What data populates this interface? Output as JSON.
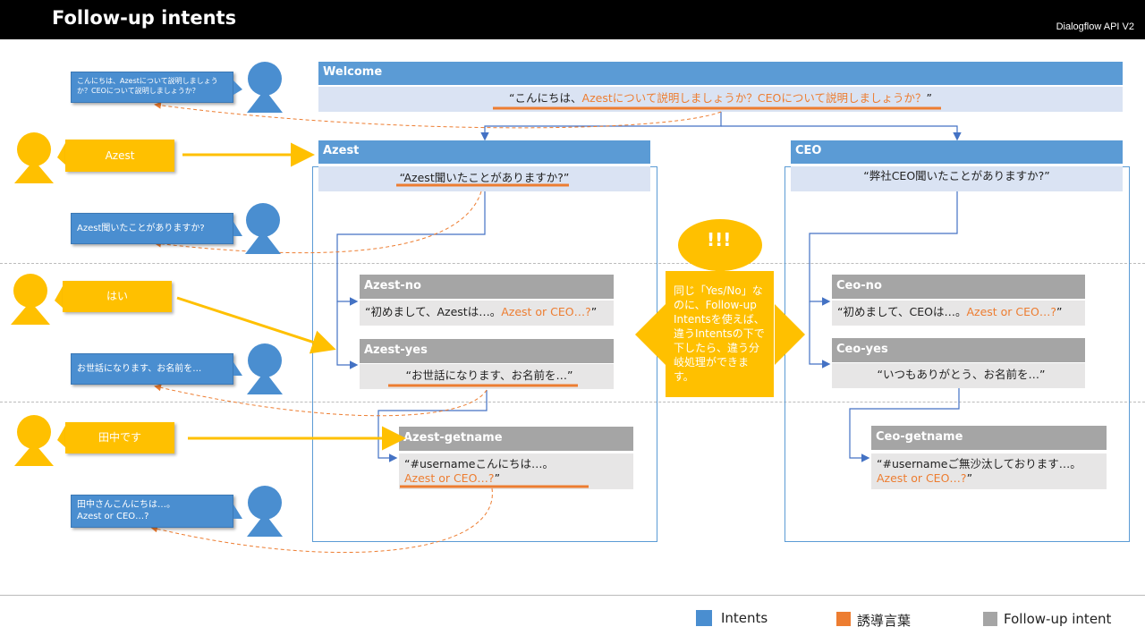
{
  "header": {
    "title": "Follow-up intents",
    "brand": "Dialogflow  API V2"
  },
  "welcome": {
    "name": "Welcome",
    "quote_open": "“こんにちは、",
    "quote_orange": "Azestについて説明しましょうか？CEOについて説明しましょうか？",
    "quote_close": "”"
  },
  "azest": {
    "name": "Azest",
    "quote": "“Azest聞いたことがありますか?”",
    "no": {
      "name": "Azest-no",
      "quote_open": "“初めまして、Azestは…。",
      "quote_orange": "Azest  or CEO…?",
      "quote_close": "”"
    },
    "yes": {
      "name": "Azest-yes",
      "quote": "“お世話になります、お名前を…”"
    },
    "getname": {
      "name": "Azest-getname",
      "quote_line1": "“#usernameこんにちは…。",
      "quote_orange": "Azest or CEO…?",
      "quote_close": "”"
    }
  },
  "ceo": {
    "name": "CEO",
    "quote": "“弊社CEO聞いたことがありますか?”",
    "no": {
      "name": "Ceo-no",
      "quote_open": "“初めまして、CEOは…。",
      "quote_orange": "Azest  or CEO…?",
      "quote_close": "”"
    },
    "yes": {
      "name": "Ceo-yes",
      "quote": "“いつもありがとう、お名前を…”"
    },
    "getname": {
      "name": "Ceo-getname",
      "quote_line1": "“#usernameご無沙汰しております…。",
      "quote_orange": "Azest or CEO…?",
      "quote_close": "”"
    }
  },
  "bot_bubbles": {
    "b1": "こんにちは、Azestについて説明しましょうか？CEOについて説明しましょうか？",
    "b2": "Azest聞いたことがありますか?",
    "b3": "お世話になります、お名前を…",
    "b4_line1": "田中さんこんにちは…。",
    "b4_line2": "Azest or CEO…?"
  },
  "user_bubbles": {
    "u1": "Azest",
    "u2": "はい",
    "u3": "田中です"
  },
  "callout": {
    "exclaim": "!!!",
    "text": "同じ「Yes/No」なのに、Follow-up Intentsを使えば、違うIntentsの下で下したら、違う分岐処理ができます。"
  },
  "legend": {
    "intents": "Intents",
    "phrase": "誘導言葉",
    "followup": "Follow-up intent"
  },
  "colors": {
    "intent_blue": "#5b9bd5",
    "orange": "#ed7d31",
    "followup_gray": "#a5a5a5",
    "user_yellow": "#ffc000"
  }
}
